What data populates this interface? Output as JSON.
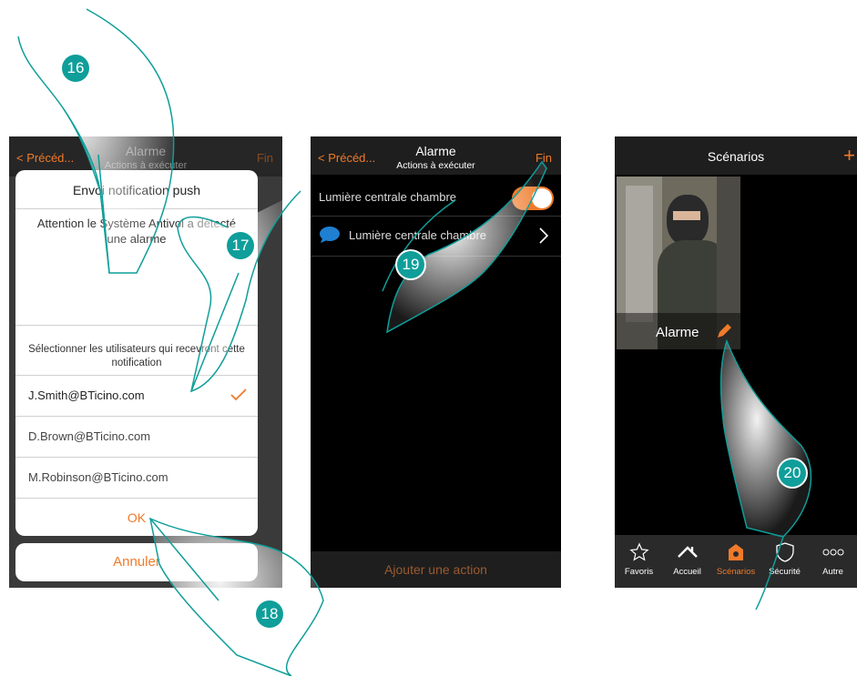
{
  "screen1": {
    "header": {
      "back_label": "Précéd...",
      "title": "Alarme",
      "subtitle": "Actions à exécuter",
      "right_label": "Fin"
    },
    "dialog": {
      "title": "Envoi notification push",
      "message": "Attention le Système Antivol a détecté une alarme",
      "users_prompt": "Sélectionner les utilisateurs qui recevront cette notification",
      "users": [
        {
          "email": "J.Smith@BTicino.com",
          "selected": true
        },
        {
          "email": "D.Brown@BTicino.com",
          "selected": false
        },
        {
          "email": "M.Robinson@BTicino.com",
          "selected": false
        }
      ],
      "ok_label": "OK",
      "cancel_label": "Annuler"
    }
  },
  "screen2": {
    "header": {
      "back_label": "Précéd...",
      "title": "Alarme",
      "subtitle": "Actions à exécuter",
      "right_label": "Fin"
    },
    "toggle_label": "Lumière centrale chambre",
    "toggle_on": true,
    "action_item_label": "Lumière centrale chambre",
    "add_action_label": "Ajouter une action"
  },
  "screen3": {
    "header": {
      "title": "Scénarios",
      "add_label": "+"
    },
    "scenario_card": {
      "label": "Alarme"
    },
    "bottom_nav": [
      {
        "label": "Favoris",
        "icon": "star-icon",
        "active": false
      },
      {
        "label": "Accueil",
        "icon": "home-icon",
        "active": false
      },
      {
        "label": "Scénarios",
        "icon": "scenarios-icon",
        "active": true
      },
      {
        "label": "Sécurité",
        "icon": "shield-icon",
        "active": false
      },
      {
        "label": "Autre",
        "icon": "more-icon",
        "active": false
      }
    ]
  },
  "step_badges": [
    "16",
    "17",
    "18",
    "19",
    "20"
  ],
  "colors": {
    "accent": "#f07a2a",
    "badge": "#0f9e9a",
    "header_bg": "#1e1e1e",
    "screen_bg": "#000000"
  }
}
